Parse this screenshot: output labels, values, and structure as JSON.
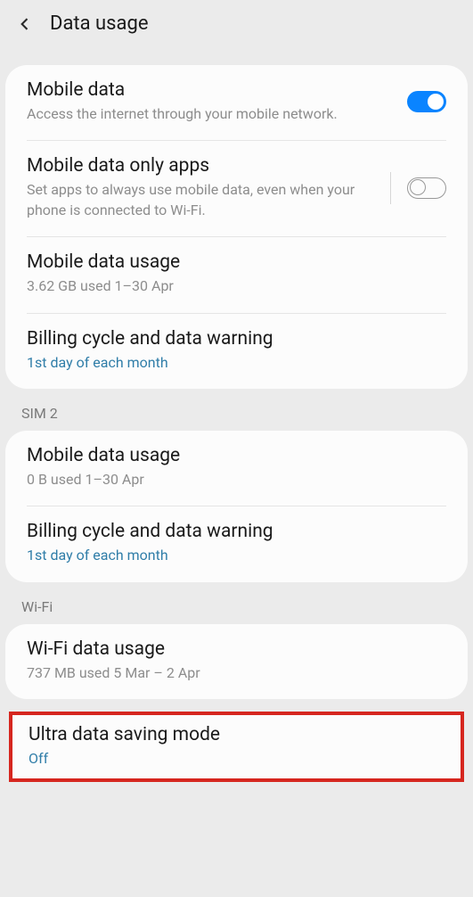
{
  "header": {
    "title": "Data usage"
  },
  "group1": {
    "mobile_data": {
      "title": "Mobile data",
      "subtitle": "Access the internet through your mobile network."
    },
    "mobile_data_only_apps": {
      "title": "Mobile data only apps",
      "subtitle": "Set apps to always use mobile data, even when your phone is connected to Wi-Fi."
    },
    "mobile_data_usage": {
      "title": "Mobile data usage",
      "subtitle": "3.62 GB used 1–30 Apr"
    },
    "billing_cycle": {
      "title": "Billing cycle and data warning",
      "subtitle": "1st day of each month"
    }
  },
  "sim2": {
    "label": "SIM 2",
    "mobile_data_usage": {
      "title": "Mobile data usage",
      "subtitle": "0 B used 1–30 Apr"
    },
    "billing_cycle": {
      "title": "Billing cycle and data warning",
      "subtitle": "1st day of each month"
    }
  },
  "wifi": {
    "label": "Wi-Fi",
    "wifi_data_usage": {
      "title": "Wi-Fi data usage",
      "subtitle": "737 MB used 5 Mar – 2 Apr"
    }
  },
  "ultra": {
    "title": "Ultra data saving mode",
    "subtitle": "Off"
  }
}
